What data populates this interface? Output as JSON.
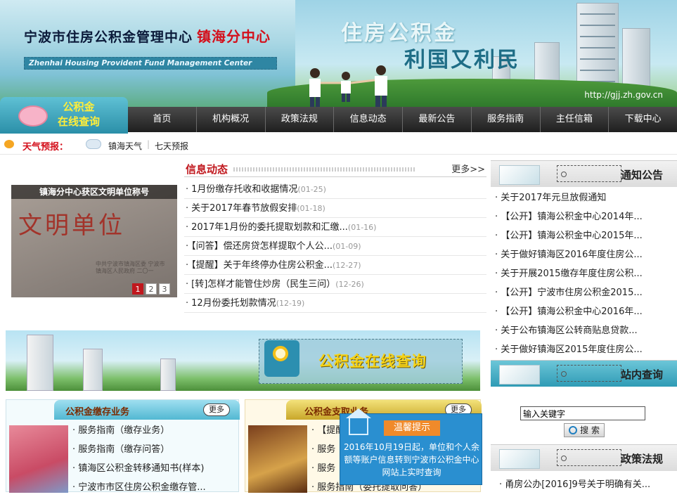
{
  "header": {
    "title_cn": "宁波市住房公积金管理中心",
    "title_branch": "镇海分中心",
    "title_en": "Zhenhai Housing Provident Fund Management Center",
    "slogan_1": "住房公积金",
    "slogan_2": "利国又利民",
    "url": "http://gjj.zh.gov.cn"
  },
  "logo": {
    "line1": "公积金",
    "line2": "在线查询"
  },
  "nav": [
    "首页",
    "机构概况",
    "政策法规",
    "信息动态",
    "最新公告",
    "服务指南",
    "主任信箱",
    "下载中心"
  ],
  "weather": {
    "label": "天气预报：",
    "today": "镇海天气",
    "separator": "|",
    "forecast": "七天预报"
  },
  "photo": {
    "caption": "镇海分中心获区文明单位称号",
    "plaque_text": "文明单位",
    "plaque_sub": "中共宁波市镇海区委 宁波市镇海区人民政府 二〇一",
    "pages": [
      "1",
      "2",
      "3"
    ],
    "active_page": "1"
  },
  "news": {
    "title": "信息动态",
    "more": "更多>>",
    "items": [
      {
        "text": "1月份缴存托收和收据情况",
        "date": "(01-25)"
      },
      {
        "text": "关于2017年春节放假安排",
        "date": "(01-18)"
      },
      {
        "text": "2017年1月份的委托提取划款和汇缴...",
        "date": "(01-16)"
      },
      {
        "text": "【问答】偿还房贷怎样提取个人公...",
        "date": "(01-09)"
      },
      {
        "text": "【提醒】关于年终停办住房公积金...",
        "date": "(12-27)"
      },
      {
        "text": "[转]怎样才能管住炒房（民生三问）",
        "date": "(12-26)"
      },
      {
        "text": "12月份委托划款情况",
        "date": "(12-19)"
      }
    ]
  },
  "notice": {
    "title": "通知公告",
    "items": [
      "关于2017年元旦放假通知",
      "【公开】镇海公积金中心2014年...",
      "【公开】镇海公积金中心2015年...",
      "关于做好镇海区2016年度住房公...",
      "关于开展2015缴存年度住房公积...",
      "【公开】宁波市住房公积金2015...",
      "【公开】镇海公积金中心2016年...",
      "关于公布镇海区公转商贴息贷款...",
      "关于做好镇海区2015年度住房公..."
    ]
  },
  "site_search": {
    "title": "站内查询",
    "input_value": "输入关键字",
    "button": "搜 索"
  },
  "policy": {
    "title": "政策法规",
    "first_item": "甬房公办[2016]9号关于明确有关..."
  },
  "query_banner": {
    "text": "公积金在线查询"
  },
  "deposit_panel": {
    "title": "公积金缴存业务",
    "more": "更多",
    "items": [
      "服务指南（缴存业务）",
      "服务指南（缴存问答）",
      "镇海区公积金转移通知书(样本)",
      "宁波市市区住房公积金缴存管..."
    ]
  },
  "withdraw_panel": {
    "title": "公积金支取业务",
    "more": "更多",
    "items": [
      "【提醒】",
      "服务",
      "服务",
      "服务指南（委托提取问答）"
    ]
  },
  "popup": {
    "header": "温馨提示",
    "body": "2016年10月19日起，单位和个人余额等账户信息转到宁波市公积金中心网站上实时查询"
  },
  "colors": {
    "accent_red": "#d40f1b",
    "nav_bg": "#2e2e2e",
    "popup_bg": "#2a8fd0",
    "popup_header": "#f08a2a"
  }
}
